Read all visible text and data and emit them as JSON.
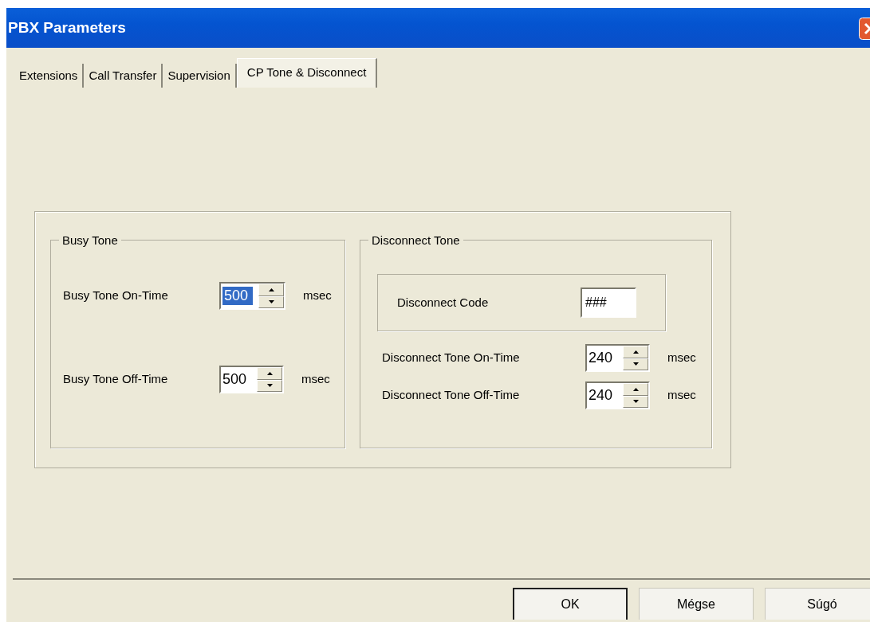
{
  "window": {
    "title": "PBX Parameters"
  },
  "tabs": [
    {
      "label": "Extensions",
      "selected": false
    },
    {
      "label": "Call Transfer",
      "selected": false
    },
    {
      "label": "Supervision",
      "selected": false
    },
    {
      "label": "CP Tone & Disconnect",
      "selected": true
    }
  ],
  "busy_tone": {
    "title": "Busy Tone",
    "fields": [
      {
        "label": "Busy Tone On-Time",
        "value": "500",
        "highlighted": true,
        "unit": "msec"
      },
      {
        "label": "Busy Tone Off-Time",
        "value": "500",
        "highlighted": false,
        "unit": "msec"
      }
    ]
  },
  "disconnect_tone": {
    "title": "Disconnect Tone",
    "code": {
      "label": "Disconnect Code",
      "value": "###"
    },
    "fields": [
      {
        "label": "Disconnect Tone On-Time",
        "value": "240",
        "highlighted": false,
        "unit": "msec"
      },
      {
        "label": "Disconnect Tone Off-Time",
        "value": "240",
        "highlighted": false,
        "unit": "msec"
      }
    ]
  },
  "buttons": [
    {
      "label": "OK",
      "default": true
    },
    {
      "label": "Mégse",
      "default": false
    },
    {
      "label": "Súgó",
      "default": false
    }
  ]
}
